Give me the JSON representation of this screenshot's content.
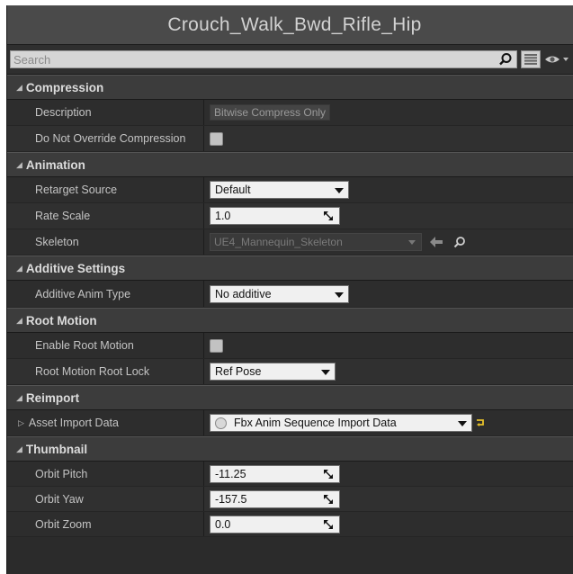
{
  "title": "Crouch_Walk_Bwd_Rifle_Hip",
  "search": {
    "placeholder": "Search"
  },
  "categories": {
    "compression": {
      "label": "Compression",
      "description_label": "Description",
      "description_value": "Bitwise Compress Only",
      "no_override_label": "Do Not Override Compression"
    },
    "animation": {
      "label": "Animation",
      "retarget_label": "Retarget Source",
      "retarget_value": "Default",
      "rate_label": "Rate Scale",
      "rate_value": "1.0",
      "skeleton_label": "Skeleton",
      "skeleton_value": "UE4_Mannequin_Skeleton"
    },
    "additive": {
      "label": "Additive Settings",
      "type_label": "Additive Anim Type",
      "type_value": "No additive"
    },
    "root_motion": {
      "label": "Root Motion",
      "enable_label": "Enable Root Motion",
      "lock_label": "Root Motion Root Lock",
      "lock_value": "Ref Pose"
    },
    "reimport": {
      "label": "Reimport",
      "asset_label": "Asset Import Data",
      "asset_value": "Fbx Anim Sequence Import Data"
    },
    "thumbnail": {
      "label": "Thumbnail",
      "pitch_label": "Orbit Pitch",
      "pitch_value": "-11.25",
      "yaw_label": "Orbit Yaw",
      "yaw_value": "-157.5",
      "zoom_label": "Orbit Zoom",
      "zoom_value": "0.0"
    }
  },
  "icons": {
    "search": "search-icon",
    "view_options": "list-view-icon",
    "visibility": "eye-icon",
    "use_selected": "arrow-left-icon",
    "browse": "browse-icon",
    "reset": "reset-icon"
  },
  "colors": {
    "panel_bg": "#2b2b2b",
    "category_bg": "#3c3c3c",
    "field_bg": "#f0f0f0",
    "reset_arrow": "#e6c12a"
  }
}
